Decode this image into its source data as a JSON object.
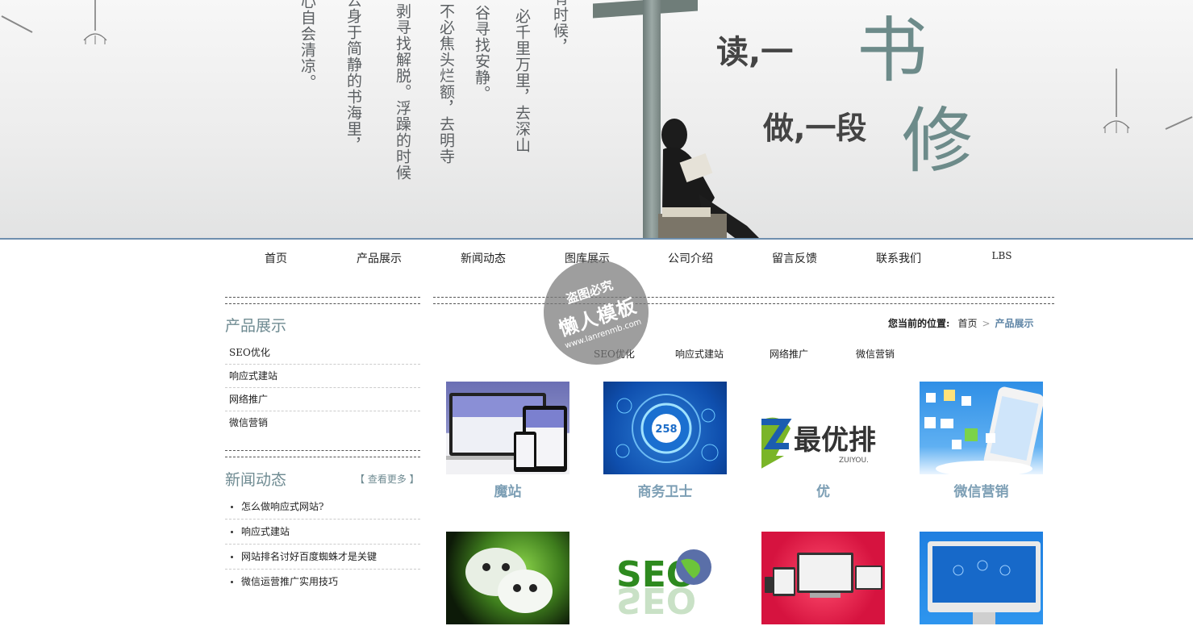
{
  "banner": {
    "columns": [
      "心自会清凉。",
      "去身于简静的书海里，",
      "剥寻找解脱。浮躁的时候",
      "不必焦头烂额，去明寺",
      "谷寻找安静。",
      "必千里万里，去深山",
      "有时候，"
    ],
    "line1_prefix": "读,一",
    "line1_big": "书",
    "line2_prefix": "做,一段",
    "line2_big": "修"
  },
  "nav": {
    "items": [
      "首页",
      "产品展示",
      "新闻动态",
      "图库展示",
      "公司介绍",
      "留言反馈",
      "联系我们",
      "LBS"
    ]
  },
  "sidebar": {
    "products_title": "产品展示",
    "products": [
      "SEO优化",
      "响应式建站",
      "网络推广",
      "微信营销"
    ],
    "news_title": "新闻动态",
    "news_more": "【 查看更多 】",
    "news": [
      "怎么做响应式网站?",
      "响应式建站",
      "网站排名讨好百度蜘蛛才是关键",
      "微信运营推广实用技巧"
    ]
  },
  "breadcrumb": {
    "label": "您当前的位置:",
    "home": "首页",
    "separator": ">",
    "current": "产品展示"
  },
  "subnav": [
    "SEO优化",
    "响应式建站",
    "网络推广",
    "微信营销"
  ],
  "products": [
    {
      "title": "魔站",
      "thumb": "devices-mockup"
    },
    {
      "title": "商务卫士",
      "thumb": "blue-258-circle"
    },
    {
      "title": "优",
      "thumb": "zuiyou-logo"
    },
    {
      "title": "微信营销",
      "thumb": "phone-apps"
    },
    {
      "title": "",
      "thumb": "wechat-bubbles"
    },
    {
      "title": "",
      "thumb": "seo-globe"
    },
    {
      "title": "",
      "thumb": "red-devices"
    },
    {
      "title": "",
      "thumb": "imac-screen"
    }
  ],
  "thumb_text": {
    "zuiyou_main": "最优排",
    "zuiyou_sub": "ZUIYOU.",
    "circle_num": "258",
    "seo_word": "SEO"
  },
  "watermark": {
    "line1": "盗图必究",
    "line2": "懒人模板",
    "line3": "www.lanrenmb.com"
  },
  "colors": {
    "accent": "#6e8fae",
    "title": "#6f8b92",
    "card_title": "#7d9fb5",
    "crumb_current": "#5f85a6"
  }
}
